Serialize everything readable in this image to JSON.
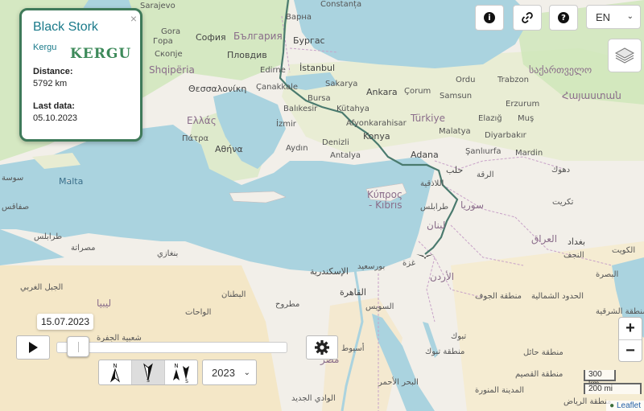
{
  "info": {
    "close": "×",
    "species": "Black Stork",
    "name": "Kergu",
    "logo": "KERGU",
    "distance_label": "Distance:",
    "distance_value": "5792 km",
    "last_label": "Last data:",
    "last_value": "05.10.2023"
  },
  "controls": {
    "info_icon": "info-icon",
    "link_icon": "link-icon",
    "help_icon": "help-icon",
    "language": "EN",
    "layers_icon": "layers-icon"
  },
  "zoom": {
    "in": "+",
    "out": "−"
  },
  "scale": {
    "km": "300 km",
    "mi": "200 mi"
  },
  "attribution": {
    "leaflet": "Leaflet"
  },
  "timeline": {
    "date": "15.07.2023",
    "year": "2023",
    "progress": 0.05,
    "direction": {
      "north": "N",
      "south": "S"
    }
  },
  "colors": {
    "track": "#4a7a6e",
    "sea": "#aad3df",
    "land": "#f2efe9",
    "forest": "#cde6b8",
    "desert": "#f5e4b8",
    "card_border": "#3f7a5a",
    "species_text": "#1a7a8a"
  },
  "places": {
    "sarajevo": "Sarajevo",
    "varna": "Варна",
    "constanta": "Constanța",
    "gora": "Gora",
    "gora2": "Гора",
    "sofia": "София",
    "bulgaria": "България",
    "burgas": "Бургас",
    "skopje": "Скопје",
    "plovdiv": "Пловдив",
    "shqiperia": "Shqipëria",
    "thessaloniki": "Θεσσαλονίκη",
    "edirne": "Edirne",
    "istanbul": "İstanbul",
    "canakkale": "Çanakkale",
    "sakarya": "Sakarya",
    "ankara": "Ankara",
    "ordu": "Ordu",
    "trabzon": "Trabzon",
    "sakartvelo": "საქართველო",
    "bursa": "Bursa",
    "corum": "Çorum",
    "samsun": "Samsun",
    "erzurum": "Erzurum",
    "hayastan": "Հայաստան",
    "balikesir": "Balıkesir",
    "kutahya": "Kütahya",
    "ellada": "Ελλάς",
    "izmir": "İzmir",
    "afyon": "Afyonkarahisar",
    "turkiye": "Türkiye",
    "elazig": "Elazığ",
    "mus": "Muş",
    "malatya": "Malatya",
    "diyarbakir": "Diyarbakır",
    "patra": "Πάτρα",
    "athina": "Αθήνα",
    "aydin": "Aydın",
    "denizli": "Denizli",
    "konya": "Konya",
    "sanliurfa": "Şanlıurfa",
    "mardin": "Mardin",
    "antalya": "Antalya",
    "adana": "Adana",
    "halab": "حلب",
    "raqqa": "الرقة",
    "dahuk": "دهوك",
    "malta": "Malta",
    "kypros": "Κύπρος",
    "kibris": "- Kıbrıs",
    "latakia": "اللاذقية",
    "suriya": "سوريا",
    "tikrit": "تكريت",
    "tarabulus": "طرابلس",
    "lubnan": "لبنان",
    "iraq": "العراق",
    "tarabulus_ly": "طرابلس",
    "misrata": "مصراتة",
    "baghdad": "بغداد",
    "najaf": "النجف",
    "kuwait": "الكويت",
    "banghazi": "بنغازي",
    "iskandariya": "الإسكندرية",
    "bursaid": "بورسعيد",
    "urdun": "الأردن",
    "basra": "البصرة",
    "gaza": "غزة",
    "jawf": "منطقة الجوف",
    "shamaliya": "الحدود الشمالية",
    "sharqiya": "المنطقة الشرقية",
    "qahira": "القاهرة",
    "suways": "السويس",
    "libya": "ليبيا",
    "jabal": "الجبل الغربي",
    "butnan": "البطنان",
    "wahat": "الواحات",
    "matruh": "مطروح",
    "tabuk": "تبوك",
    "hail": "منطقة حائل",
    "tabuk_r": "منطقة تبوك",
    "qasim": "منطقة القصيم",
    "asyut": "أسيوط",
    "misr": "مصر",
    "jufra": "شعبية الجفرة",
    "ahmar": "البحر الأحمر",
    "madina": "المدينة المنورة",
    "wadi": "الوادي الجديد",
    "riyadh": "منطقة الرياض",
    "sousse": "سوسة",
    "sfax": "صفاقس"
  }
}
